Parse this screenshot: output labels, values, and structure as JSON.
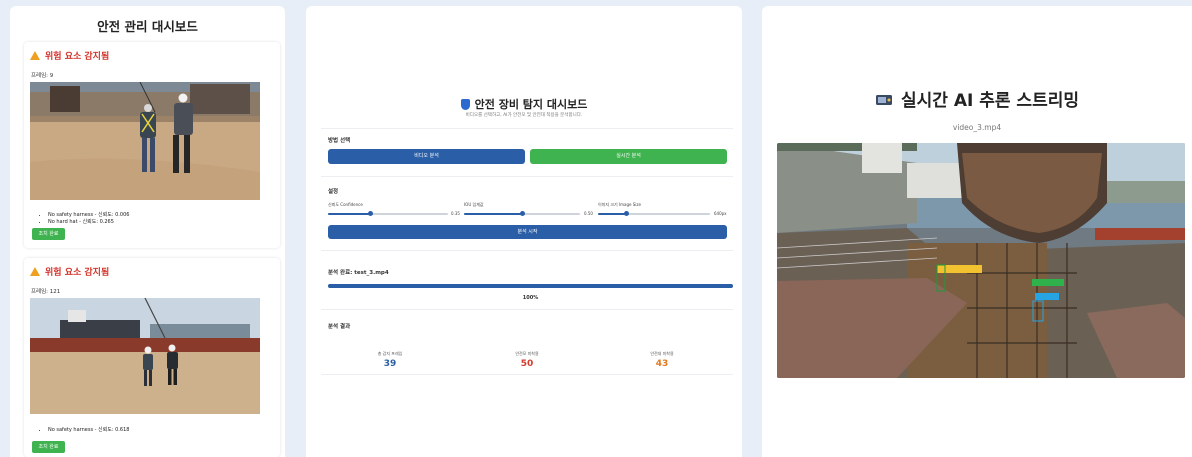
{
  "panel1": {
    "title": "안전 관리 대시보드",
    "alerts": [
      {
        "title": "위험 요소 감지됨",
        "time": "프레임: 9",
        "violations": [
          "No safety harness - 신뢰도: 0.006",
          "No hard hat - 신뢰도: 0.265"
        ],
        "button": "조치 완료"
      },
      {
        "title": "위험 요소 감지됨",
        "time": "프레임: 121",
        "violations": [
          "No safety harness - 신뢰도: 0.618"
        ],
        "button": "조치 완료"
      }
    ],
    "icons": {
      "alert": "warning-triangle-icon"
    }
  },
  "panel2": {
    "title": "안전 장비 탐지 대시보드",
    "subtitle": "비디오를 선택하고, AI가 안전모 및 안전대 착용을 분석합니다.",
    "mode_section": {
      "label": "방법 선택",
      "upload_button": "비디오 분석",
      "realtime_button": "실시간 분석"
    },
    "settings": {
      "label": "설정",
      "sliders": [
        {
          "label": "신뢰도 Confidence",
          "value_text": "0.35",
          "value": 0.35
        },
        {
          "label": "IOU 임계값",
          "value_text": "0.50",
          "value": 0.5
        },
        {
          "label": "이미지 크기 Image Size",
          "value_text": "640px",
          "value": 0.25
        }
      ],
      "start_button": "분석 시작"
    },
    "progress": {
      "label": "분석 완료: test_3.mp4",
      "percent": 100,
      "percent_text": "100%"
    },
    "results": {
      "label": "분석 결과",
      "stats": [
        {
          "label": "총 감지 프레임",
          "value": "39",
          "color": "#2a5ea7"
        },
        {
          "label": "안전모 미착용",
          "value": "50",
          "color": "#d23b2b"
        },
        {
          "label": "안전대 미착용",
          "value": "43",
          "color": "#e07a1f"
        }
      ]
    },
    "colors": {
      "primary": "#2a5ea7",
      "success": "#3fb34f"
    },
    "icons": {
      "header": "shield-icon"
    }
  },
  "panel3": {
    "title": "실시간 AI 추론 스트리밍",
    "file": "video_3.mp4",
    "icons": {
      "header": "video-camera-icon"
    }
  }
}
